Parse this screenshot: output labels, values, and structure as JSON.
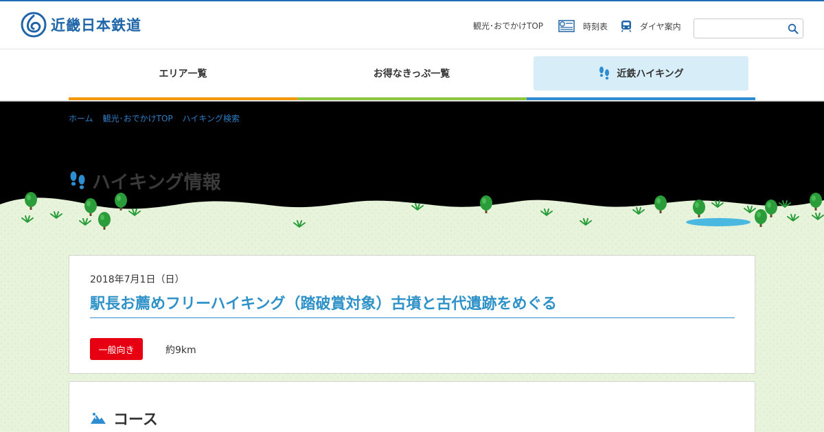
{
  "header": {
    "logo_text": "近畿日本鉄道",
    "links": [
      {
        "label": "観光･おでかけTOP"
      },
      {
        "label": "時刻表"
      },
      {
        "label": "ダイヤ案内"
      }
    ],
    "search": {
      "placeholder": "",
      "value": ""
    }
  },
  "nav": {
    "items": [
      {
        "label": "エリア一覧",
        "line_color": "#f39800"
      },
      {
        "label": "お得なきっぷ一覧",
        "line_color": "#8cc63f"
      },
      {
        "label": "近鉄ハイキング",
        "line_color": "#2e8cd0",
        "active": true
      }
    ]
  },
  "breadcrumb": [
    "ホーム",
    "観光･おでかけTOP",
    "ハイキング検索"
  ],
  "page_title": "ハイキング情報",
  "event": {
    "date": "2018年7月1日（日）",
    "title": "駅長お薦めフリーハイキング（踏破賞対象）古墳と古代遺跡をめぐる",
    "level_badge": "一般向き",
    "distance": "約9km"
  },
  "course": {
    "heading": "コース"
  },
  "colors": {
    "brand_blue": "#1e64a8",
    "link_blue": "#2e7ec4",
    "title_blue": "#2e92c8",
    "badge_red": "#e60012",
    "ground_green": "#e8f3dc",
    "tree_green": "#2a9c3a",
    "pond_blue": "#4bb8e0"
  }
}
